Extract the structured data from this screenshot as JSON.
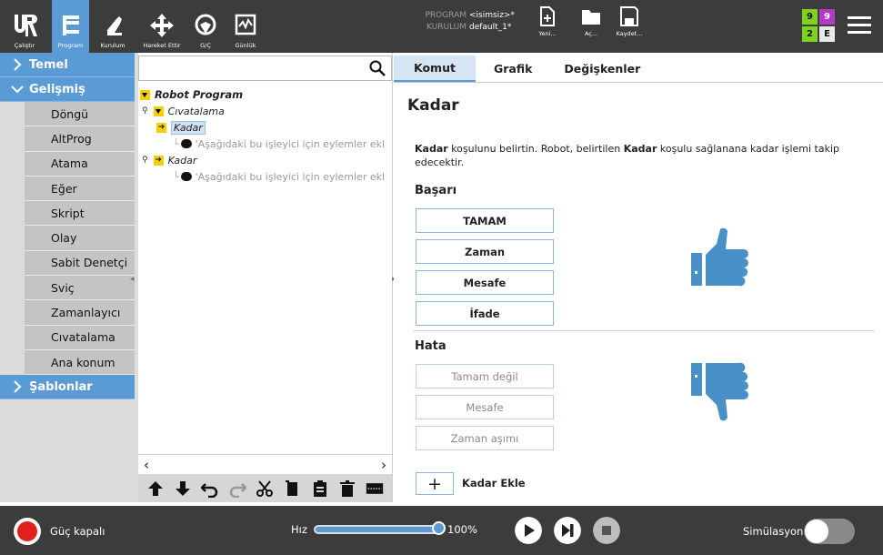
{
  "topbar": {
    "buttons": [
      {
        "label": "Çalıştır",
        "icon": "ur-logo-icon"
      },
      {
        "label": "Program",
        "icon": "program-icon"
      },
      {
        "label": "Kurulum",
        "icon": "robot-arm-icon"
      },
      {
        "label": "Hareket Ettir",
        "icon": "move-arrows-icon"
      },
      {
        "label": "G/Ç",
        "icon": "io-icon"
      },
      {
        "label": "Günlük",
        "icon": "log-icon"
      }
    ],
    "program_key": "PROGRAM",
    "program_value": "<isimsiz>*",
    "installation_key": "KURULUM",
    "installation_value": "default_1*",
    "file_buttons": [
      {
        "label": "Yeni...",
        "icon": "new-file-icon"
      },
      {
        "label": "Aç...",
        "icon": "open-folder-icon"
      },
      {
        "label": "Kaydet...",
        "icon": "save-icon"
      }
    ],
    "badge": [
      "9",
      "9",
      "2",
      "E"
    ],
    "badge_colors": [
      "#7fd21e",
      "#b03cc8",
      "#7fd21e",
      "#e8e8e8"
    ]
  },
  "sidebar": {
    "categories": [
      {
        "label": "Temel",
        "expanded": false
      },
      {
        "label": "Gelişmiş",
        "expanded": true
      },
      {
        "label": "Şablonlar",
        "expanded": false
      }
    ],
    "items": [
      "Döngü",
      "AltProg",
      "Atama",
      "Eğer",
      "Skript",
      "Olay",
      "Sabit Denetçi",
      "Sviç",
      "Zamanlayıcı",
      "Cıvatalama",
      "Ana konum"
    ]
  },
  "tree": {
    "search_placeholder": "",
    "nodes": [
      {
        "text": "Robot Program",
        "level": 0
      },
      {
        "text": "Cıvatalama",
        "level": 1
      },
      {
        "text": "Kadar",
        "level": 2,
        "selected": true
      },
      {
        "text": "'Aşağıdaki bu işleyici için eylemler ekl",
        "level": 3
      },
      {
        "text": "Kadar",
        "level": 2
      },
      {
        "text": "'Aşağıdaki bu işleyici için eylemler ekl",
        "level": 3
      }
    ]
  },
  "panel": {
    "tabs": [
      "Komut",
      "Grafik",
      "Değişkenler"
    ],
    "active_tab": "Komut",
    "title": "Kadar",
    "desc_b1": "Kadar",
    "desc_t1": " koşulunu belirtin. Robot, belirtilen ",
    "desc_b2": "Kadar",
    "desc_t2": " koşulu sağlanana kadar işlemi takip edecektir.",
    "success_title": "Başarı",
    "success_options": [
      "TAMAM",
      "Zaman",
      "Mesafe",
      "İfade"
    ],
    "failure_title": "Hata",
    "failure_options": [
      "Tamam değil",
      "Mesafe",
      "Zaman aşımı"
    ],
    "add_label": "Kadar Ekle",
    "add_symbol": "+"
  },
  "bottombar": {
    "power_label": "Güç kapalı",
    "speed_label": "Hız",
    "speed_value": "100%",
    "speed_fraction": 1.0,
    "simulation_label": "Simülasyon",
    "simulation_on": false
  },
  "colors": {
    "accent": "#5b9bd5",
    "topbar_bg": "#3c3c3c",
    "power_red": "#e0201a",
    "tree_icon_yellow": "#f5d000"
  }
}
